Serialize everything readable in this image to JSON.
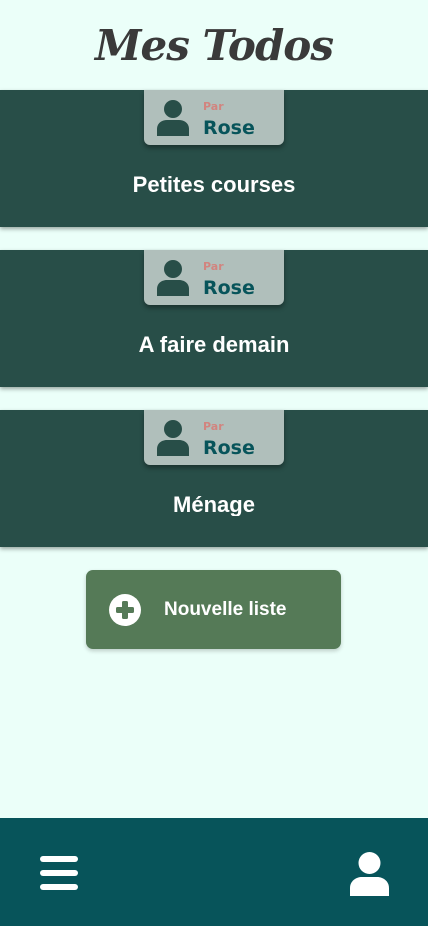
{
  "header": {
    "title": "Mes Todos"
  },
  "lists": [
    {
      "title": "Petites courses",
      "owner_prefix": "Par",
      "owner_name": "Rose"
    },
    {
      "title": "A faire demain",
      "owner_prefix": "Par",
      "owner_name": "Rose"
    },
    {
      "title": "Ménage",
      "owner_prefix": "Par",
      "owner_name": "Rose"
    }
  ],
  "new_list_button": {
    "label": "Nouvelle liste",
    "icon": "plus-circle-icon"
  },
  "bottom_nav": {
    "menu_icon": "hamburger-menu-icon",
    "profile_icon": "user-icon"
  },
  "colors": {
    "background": "#ebfff9",
    "card": "#284e48",
    "badge": "#b0bfbb",
    "owner_name": "#07545a",
    "owner_prefix": "#d2847f",
    "button": "#557a57",
    "bottom_bar": "#07545a"
  }
}
